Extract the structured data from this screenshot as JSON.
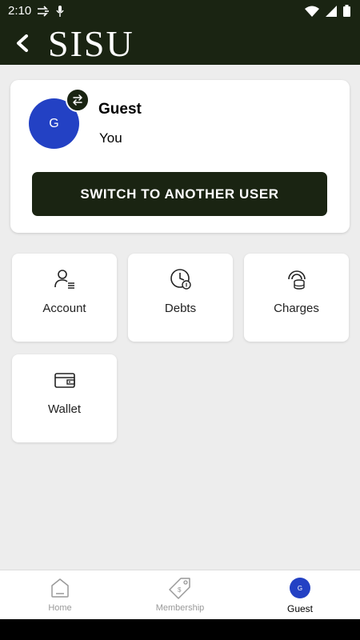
{
  "status_bar": {
    "time": "2:10",
    "icons_left": [
      "send-icon",
      "mic-icon"
    ],
    "icons_right": [
      "wifi-icon",
      "signal-icon",
      "battery-icon"
    ]
  },
  "app_bar": {
    "logo": "SISU",
    "background": "#1a2412"
  },
  "profile": {
    "avatar_initial": "G",
    "name": "Guest",
    "role": "You",
    "switch_button": "SWITCH TO ANOTHER USER",
    "avatar_color": "#2341c4"
  },
  "tiles": [
    {
      "label": "Account",
      "icon": "account-icon"
    },
    {
      "label": "Debts",
      "icon": "debts-icon"
    },
    {
      "label": "Charges",
      "icon": "charges-icon"
    },
    {
      "label": "Wallet",
      "icon": "wallet-icon"
    }
  ],
  "bottom_nav": {
    "items": [
      {
        "label": "Home",
        "icon": "home-icon",
        "active": false
      },
      {
        "label": "Membership",
        "icon": "membership-tag-icon",
        "active": false
      },
      {
        "label": "Guest",
        "icon": "guest-avatar",
        "active": true,
        "avatar_initial": "G"
      }
    ]
  }
}
